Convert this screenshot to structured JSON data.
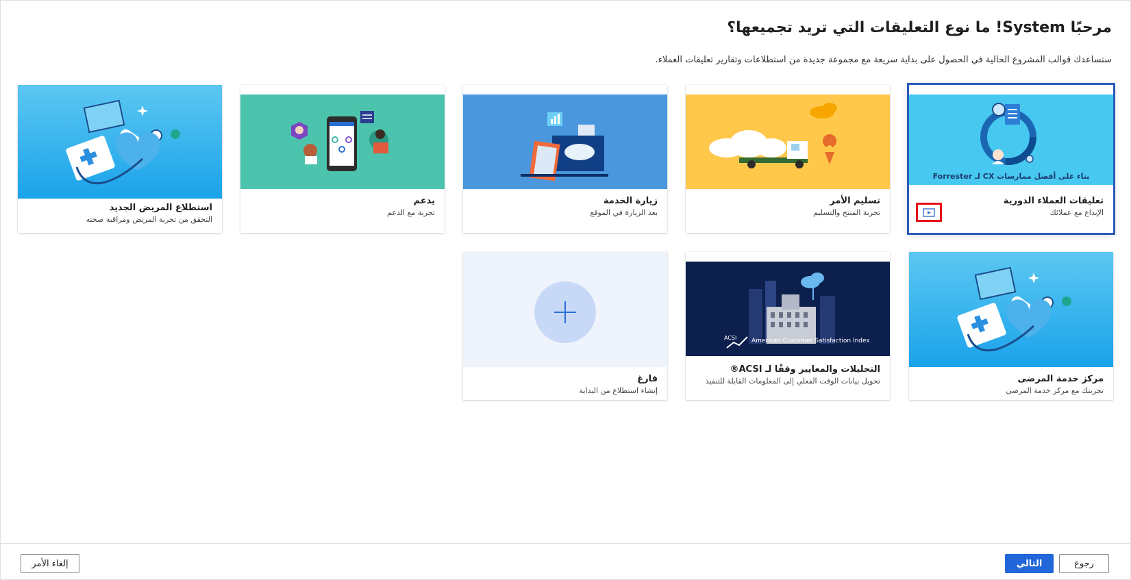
{
  "header": {
    "title": "مرحبًا System! ما نوع التعليقات التي تريد تجميعها؟",
    "subtitle": "ستساعدك قوالب المشروع الحالية في الحصول على بداية سريعة مع مجموعة جديدة من استطلاعات وتقارير تعليقات العملاء."
  },
  "templates": [
    {
      "title": "تعليقات العملاء الدورية",
      "description": "الإبداع مع عملائك",
      "banner": "بناء على أفضل ممارسات CX لـ Forrester",
      "icon": "video-icon",
      "selected": true
    },
    {
      "title": "تسليم الأمر",
      "description": "تجربة المنتج والتسليم"
    },
    {
      "title": "زيارة الخدمة",
      "description": "بعد الزيارة في الموقع"
    },
    {
      "title": "يدعم",
      "description": "تجربة مع الدعم"
    },
    {
      "title": "استطلاع المريض الجديد",
      "description": "التحقق من تجربة المريض ومراقبة صحته"
    },
    {
      "title": "مركز خدمة المرضى",
      "description": "تجربتك مع مركز خدمة المرضى"
    },
    {
      "title": "التحليلات والمعايير وفقًا لـ ACSI®",
      "description": "تحويل بيانات الوقت الفعلي إلى المعلومات القابلة للتنفيذ",
      "banner": "American Customer Satisfaction Index",
      "badge": "ACSI"
    },
    {
      "title": "فارغ",
      "description": "إنشاء استطلاع من البداية",
      "icon": "plus-icon"
    }
  ],
  "footer": {
    "cancel_label": "إلغاء الأمر",
    "next_label": "التالي",
    "back_label": "رجوع"
  },
  "colors": {
    "primary": "#2167d9",
    "selected_outline": "#2b5aba",
    "highlight_box": "#e4111a",
    "card_cyan": "#47c8f0",
    "card_yellow": "#ffc84a",
    "card_blue": "#4a97dd",
    "card_teal": "#4cc4ad",
    "card_navy": "#0c1f4d",
    "card_blank": "#eef3fc"
  }
}
